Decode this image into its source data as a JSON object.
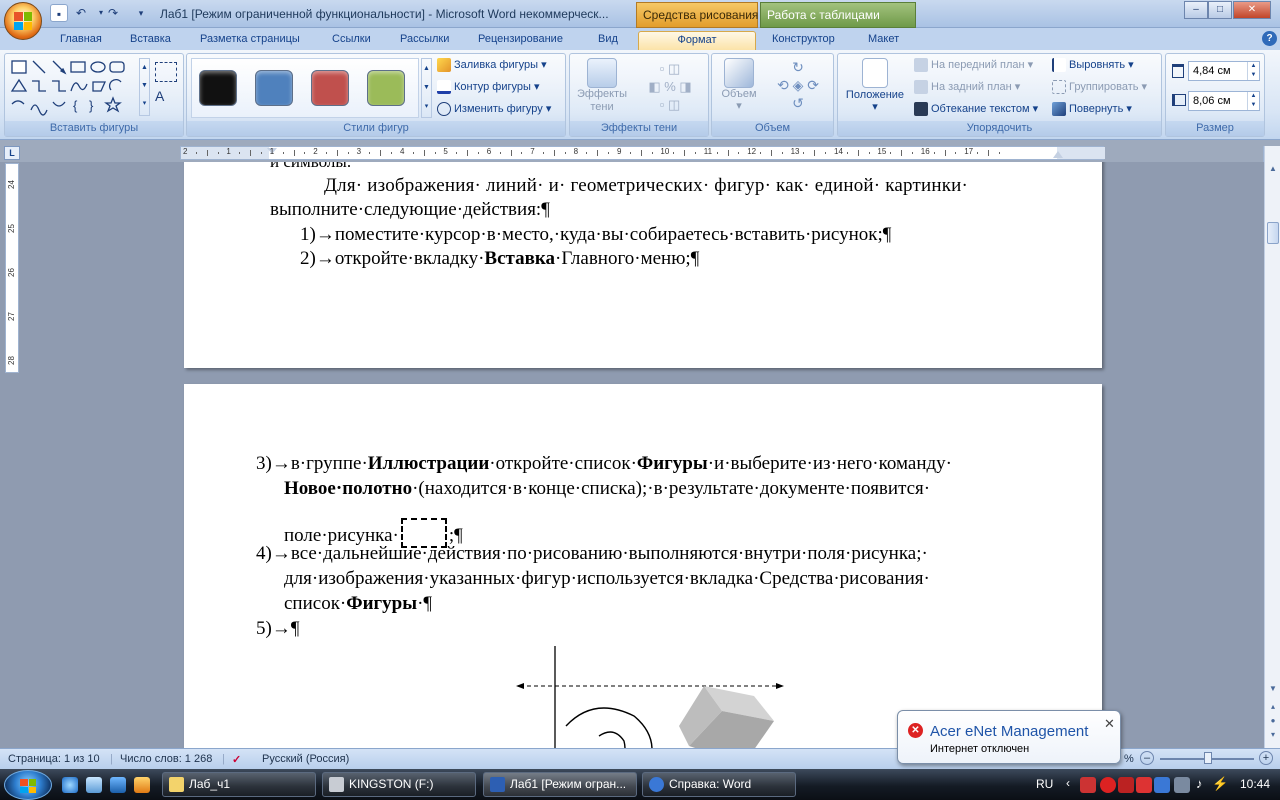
{
  "window": {
    "title": "Лаб1 [Режим ограниченной функциональности] - Microsoft Word некоммерческ...",
    "contextual_tabs": [
      "Средства рисования",
      "Работа с таблицами"
    ],
    "controls": {
      "minimize": "–",
      "maximize": "□",
      "close": "✕"
    }
  },
  "ribbon": {
    "tabs": [
      "Главная",
      "Вставка",
      "Разметка страницы",
      "Ссылки",
      "Рассылки",
      "Рецензирование",
      "Вид",
      "Формат",
      "Конструктор",
      "Макет"
    ],
    "active_tab": "Формат",
    "groups": {
      "insert_shapes": "Вставить фигуры",
      "shape_styles": "Стили фигур",
      "shadow_effects": "Эффекты тени",
      "volume": "Объем",
      "arrange": "Упорядочить",
      "size": "Размер"
    },
    "shape_styles": {
      "fill": "Заливка фигуры",
      "outline": "Контур фигуры",
      "change": "Изменить фигуру",
      "swatches": [
        "#111111",
        "#4f81bd",
        "#c0504d",
        "#9bbb59"
      ]
    },
    "shadow": {
      "effects_label": "Эффекты",
      "effects_label2": "тени"
    },
    "volume": {
      "label": "Объем"
    },
    "arrange": {
      "position": "Положение",
      "bring_front": "На передний план",
      "send_back": "На задний план",
      "wrap": "Обтекание текстом",
      "align": "Выровнять",
      "group": "Группировать",
      "rotate": "Повернуть"
    },
    "size": {
      "height": "4,84 см",
      "width": "8,06 см"
    }
  },
  "ruler": {
    "h_labels": [
      "2",
      "1",
      "1",
      "2",
      "3",
      "4",
      "5",
      "6",
      "7",
      "8",
      "9",
      "10",
      "11",
      "12",
      "13",
      "14",
      "15",
      "16",
      "17"
    ],
    "v_labels": [
      "24",
      "25",
      "26",
      "27",
      "28"
    ]
  },
  "document": {
    "page1": {
      "line0": "и символы.",
      "para1_line1": "Для· изображения· линий· и· геометрических· фигур· как· единой· картинки·",
      "para1_line2": "выполните·следующие·действия:¶",
      "item1_num": "1)",
      "item1": "поместите·курсор·в·место,·куда·вы·собираетесь·вставить·рисунок;¶",
      "item2_num": "2)",
      "item2_pre": "откройте·вкладку·",
      "item2_bold": "Вставка",
      "item2_post": "·Главного·меню;¶"
    },
    "page2": {
      "item3_num": "3)",
      "item3_a": "в·группе·",
      "item3_b": "Иллюстрации",
      "item3_c": "·откройте·список·",
      "item3_d": "Фигуры",
      "item3_e": "·и·выберите·из·него·команду·",
      "item3_f": "Новое·полотно",
      "item3_g": "·(находится·в·конце·списка);·в·результате·документе·появится·",
      "item3_h": "поле·рисунка·",
      "item3_i": ";¶",
      "item4_num": "4)",
      "item4_a": "все·дальнейшие·действия·по·рисованию·выполняются·внутри·поля·рисунка;·",
      "item4_b": "для·изображения·указанных·фигур·используется·вкладка·Средства·рисования·",
      "item4_c": "список·",
      "item4_d": "Фигуры",
      "item4_e": "·¶",
      "item5_num": "5)",
      "item5": "¶"
    }
  },
  "status": {
    "page": "Страница: 1 из 10",
    "words": "Число слов: 1 268",
    "language": "Русский (Россия)",
    "zoom_fragment": "%"
  },
  "taskbar": {
    "items": [
      "Лаб_ч1",
      "KINGSTON (F:)",
      "Лаб1 [Режим огран...",
      "Справка: Word"
    ],
    "lang": "RU",
    "clock": "10:44"
  },
  "balloon": {
    "title": "Acer eNet Management",
    "message": "Интернет отключен"
  }
}
